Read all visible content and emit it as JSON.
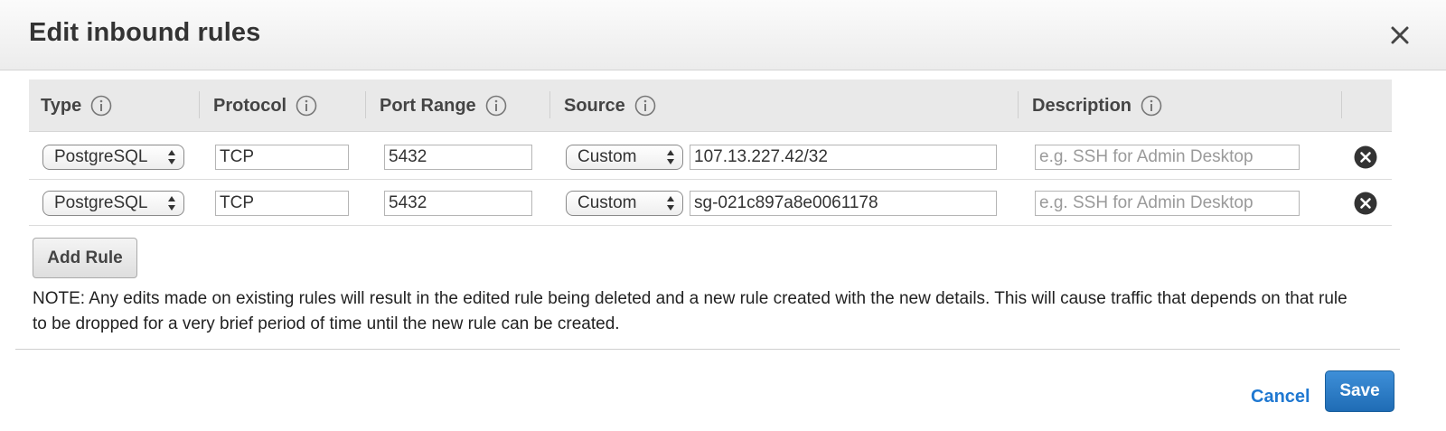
{
  "dialog": {
    "title": "Edit inbound rules",
    "close_icon": "close-icon"
  },
  "columns": [
    {
      "label": "Type",
      "icon": "info-icon"
    },
    {
      "label": "Protocol",
      "icon": "info-icon"
    },
    {
      "label": "Port Range",
      "icon": "info-icon"
    },
    {
      "label": "Source",
      "icon": "info-icon"
    },
    {
      "label": "Description",
      "icon": "info-icon"
    }
  ],
  "rules": [
    {
      "type": "PostgreSQL",
      "protocol": "TCP",
      "port_range": "5432",
      "source_type": "Custom",
      "source_value": "107.13.227.42/32",
      "description": "",
      "description_placeholder": "e.g. SSH for Admin Desktop",
      "remove_icon": "remove-icon"
    },
    {
      "type": "PostgreSQL",
      "protocol": "TCP",
      "port_range": "5432",
      "source_type": "Custom",
      "source_value": "sg-021c897a8e0061178",
      "description": "",
      "description_placeholder": "e.g. SSH for Admin Desktop",
      "remove_icon": "remove-icon"
    }
  ],
  "add_rule_label": "Add Rule",
  "note": "NOTE: Any edits made on existing rules will result in the edited rule being deleted and a new rule created with the new details. This will cause traffic that depends on that rule to be dropped for a very brief period of time until the new rule can be created.",
  "footer": {
    "cancel_label": "Cancel",
    "save_label": "Save"
  },
  "colors": {
    "primary": "#1f6cb5",
    "link": "#1f78d1",
    "header_bg": "#ececec"
  }
}
